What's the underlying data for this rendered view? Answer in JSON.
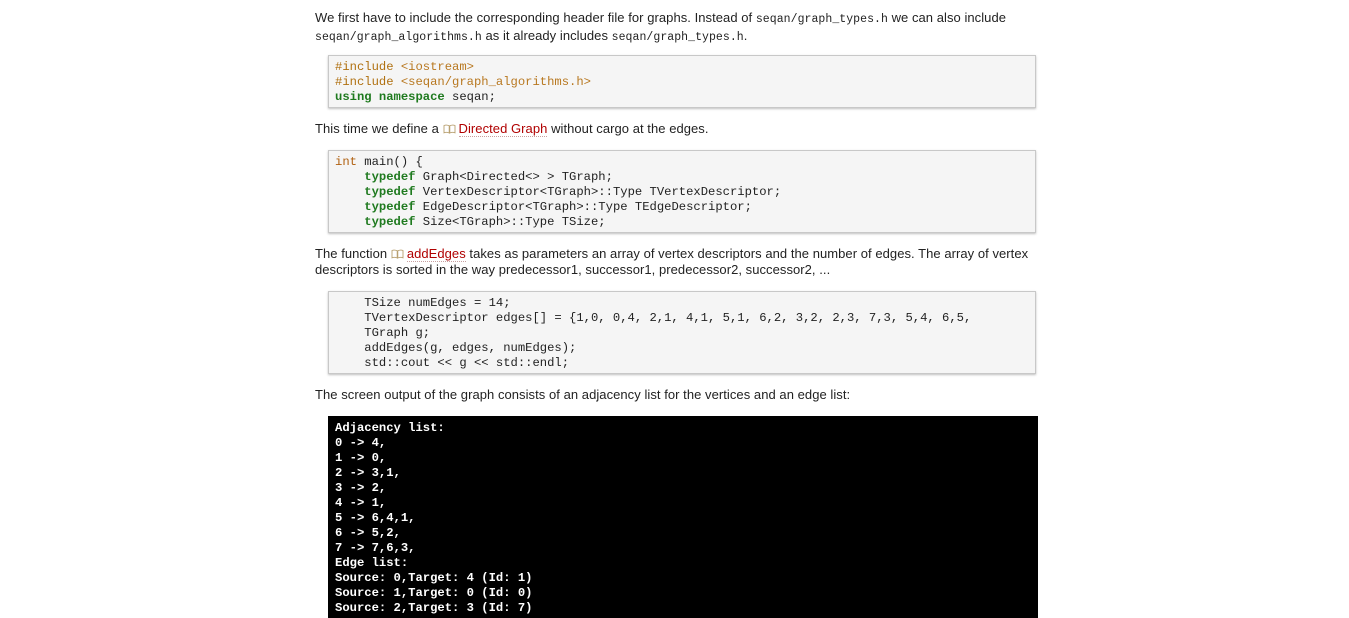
{
  "colors": {
    "link": "#b00000",
    "keyword": "#1f7a1f",
    "preprocessor": "#b07010",
    "terminal_bg": "#000000",
    "terminal_fg": "#ffffff",
    "code_bg": "#f5f5f5"
  },
  "para1": {
    "t1": "We first have to include the corresponding header file for graphs. Instead of ",
    "c1": "seqan/graph_types.h",
    "t2": " we can also include ",
    "c2": "seqan/graph_algorithms.h",
    "t3": " as it already includes ",
    "c3": "seqan/graph_types.h",
    "t4": "."
  },
  "code1": {
    "l1_pp": "#include ",
    "l1_inc": "<iostream>",
    "l2_pp": "#include ",
    "l2_inc": "<seqan/graph_algorithms.h>",
    "l3_kw1": "using",
    "l3_kw2": "namespace",
    "l3_rest": " seqan;"
  },
  "para2": {
    "t1": "This time we define a ",
    "link": "Directed Graph",
    "link_icon": "book-icon",
    "t2": " without cargo at the edges."
  },
  "code2": {
    "l1_kw": "int",
    "l1_rest": " main() {",
    "indent": "    ",
    "typedef_kw": "typedef",
    "l2_rest": " Graph<Directed<> > TGraph;",
    "l3_rest": " VertexDescriptor<TGraph>::Type TVertexDescriptor;",
    "l4_rest": " EdgeDescriptor<TGraph>::Type TEdgeDescriptor;",
    "l5_rest": " Size<TGraph>::Type TSize;"
  },
  "para3": {
    "t1": "The function ",
    "link": "addEdges",
    "link_icon": "book-icon",
    "t2": " takes as parameters an array of vertex descriptors and the number of edges. The array of vertex descriptors is sorted in the way predecessor1, successor1, predecessor2, successor2, ..."
  },
  "code3": {
    "lines": [
      "    TSize numEdges = 14;",
      "    TVertexDescriptor edges[] = {1,0, 0,4, 2,1, 4,1, 5,1, 6,2, 3,2, 2,3, 7,3, 5,4, 6,5,",
      "    TGraph g;",
      "    addEdges(g, edges, numEdges);",
      "    std::cout << g << std::endl;"
    ]
  },
  "para4": {
    "t1": "The screen output of the graph consists of an adjacency list for the vertices and an edge list:"
  },
  "terminal": {
    "lines": [
      "Adjacency list:",
      "0 -> 4,",
      "1 -> 0,",
      "2 -> 3,1,",
      "3 -> 2,",
      "4 -> 1,",
      "5 -> 6,4,1,",
      "6 -> 5,2,",
      "7 -> 7,6,3,",
      "Edge list:",
      "Source: 0,Target: 4 (Id: 1)",
      "Source: 1,Target: 0 (Id: 0)",
      "Source: 2,Target: 3 (Id: 7)"
    ]
  }
}
